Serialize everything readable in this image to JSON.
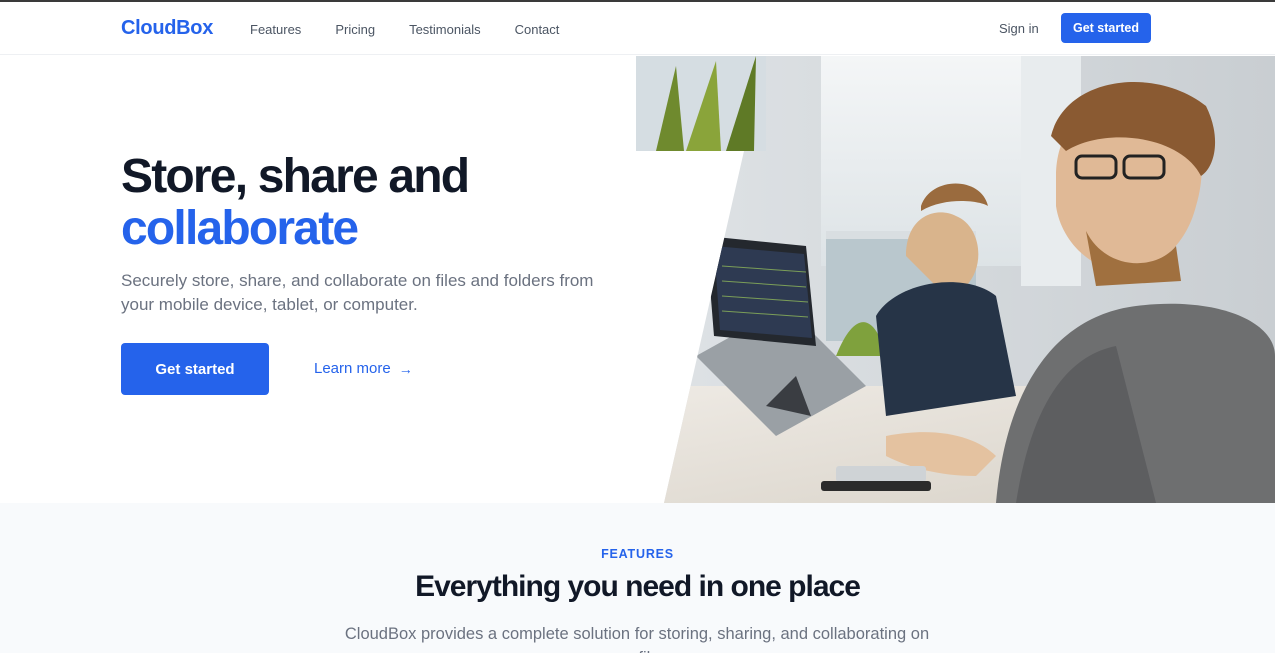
{
  "nav": {
    "brand": "CloudBox",
    "links": [
      "Features",
      "Pricing",
      "Testimonials",
      "Contact"
    ],
    "sign_in": "Sign in",
    "cta": "Get started"
  },
  "hero": {
    "title_line1": "Store, share and",
    "title_line2": "collaborate",
    "subtitle": "Securely store, share, and collaborate on files and folders from your mobile device, tablet, or computer.",
    "primary_cta": "Get started",
    "secondary_cta": "Learn more",
    "secondary_icon": "arrow-right-icon"
  },
  "features": {
    "eyebrow": "FEATURES",
    "title": "Everything you need in one place",
    "subtitle": "CloudBox provides a complete solution for storing, sharing, and collaborating on your files."
  },
  "colors": {
    "brand": "#2563eb",
    "heading": "#111827",
    "muted": "#6b7280",
    "section_bg": "#f8fafc"
  }
}
